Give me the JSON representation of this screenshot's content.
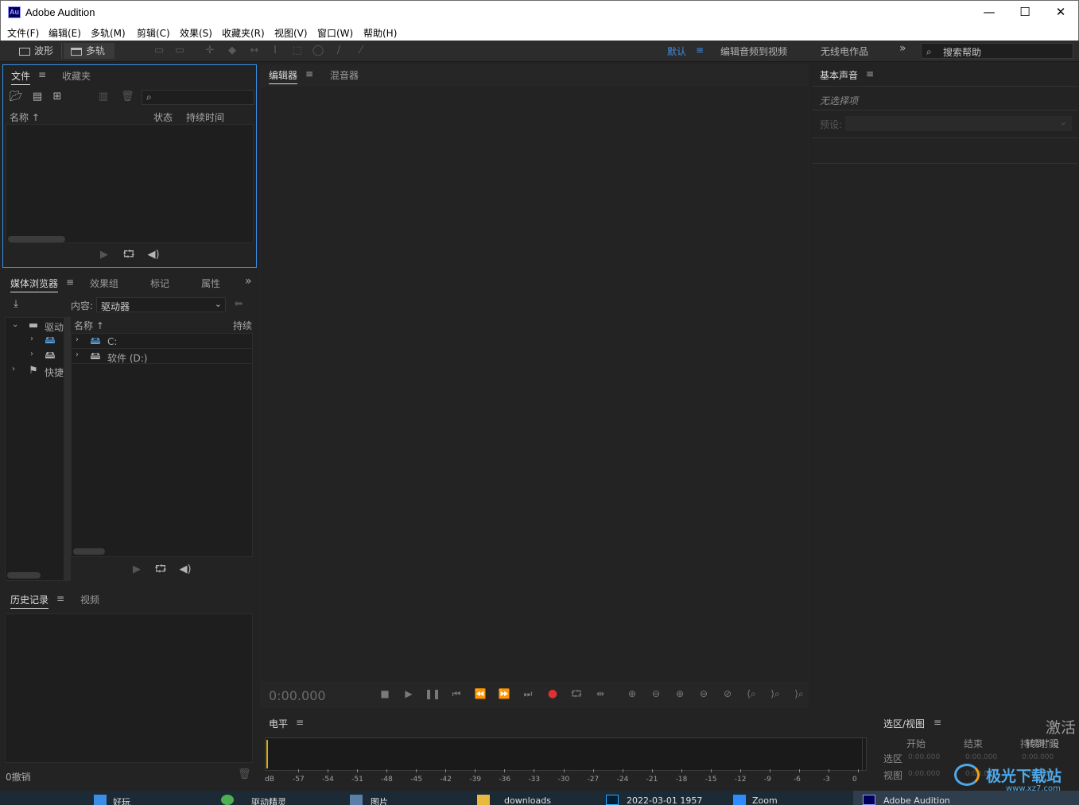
{
  "window": {
    "app_icon_text": "Au",
    "title": "Adobe Audition",
    "minimize": "—",
    "maximize": "☐",
    "close": "✕"
  },
  "menu": [
    "文件(F)",
    "编辑(E)",
    "多轨(M)",
    "剪辑(C)",
    "效果(S)",
    "收藏夹(R)",
    "视图(V)",
    "窗口(W)",
    "帮助(H)"
  ],
  "toolbar": {
    "waveform_label": "波形",
    "multitrack_label": "多轨",
    "workspaces": {
      "default": "默认",
      "edit_audio_to_video": "编辑音频到视频",
      "radio_production": "无线电作品",
      "more": "»"
    },
    "search_help": "搜索帮助"
  },
  "files_panel": {
    "tabs": [
      "文件",
      "收藏夹"
    ],
    "columns": [
      "名称",
      "状态",
      "持续时间"
    ]
  },
  "media_panel": {
    "tabs": [
      "媒体浏览器",
      "效果组",
      "标记",
      "属性"
    ],
    "content_label": "内容:",
    "content_value": "驱动器",
    "tree": [
      "驱动",
      "快捷"
    ],
    "columns": [
      "名称",
      "持续"
    ],
    "items": [
      "C:",
      "软件 (D:)"
    ]
  },
  "history_panel": {
    "tabs": [
      "历史记录",
      "视频"
    ],
    "undo_label": "0撤销"
  },
  "editor_panel": {
    "tabs": [
      "编辑器",
      "混音器"
    ],
    "time": "0:00.000"
  },
  "essential_sound": {
    "title": "基本声音",
    "no_selection": "无选择项",
    "preset_label": "预设:"
  },
  "levels_panel": {
    "title": "电平",
    "scale": [
      "dB",
      "-57",
      "-54",
      "-51",
      "-48",
      "-45",
      "-42",
      "-39",
      "-36",
      "-33",
      "-30",
      "-27",
      "-24",
      "-21",
      "-18",
      "-15",
      "-12",
      "-9",
      "-6",
      "-3",
      "0"
    ]
  },
  "selection_view": {
    "title": "选区/视图",
    "headers": [
      "开始",
      "结束",
      "持续时间"
    ],
    "rows": [
      {
        "label": "选区",
        "values": [
          "0:00.000",
          "0:00.000",
          "0:00.000"
        ]
      },
      {
        "label": "视图",
        "values": [
          "0:00.000",
          "0:00.000",
          "0:00.000"
        ]
      }
    ]
  },
  "overlay": {
    "activate": "激活",
    "activate_sub": "转到“设",
    "watermark": "极光下载站",
    "watermark_url": "www.xz7.com"
  },
  "taskbar": {
    "items": [
      "好玩",
      "驱动精灵",
      "图片",
      "downloads",
      "2022-03-01 1957",
      "Zoom",
      "Adobe Audition"
    ]
  },
  "colors": {
    "accent_blue": "#3a8ee6",
    "record_red": "#e03030",
    "background": "#232323",
    "title_bg": "#ffffff"
  }
}
